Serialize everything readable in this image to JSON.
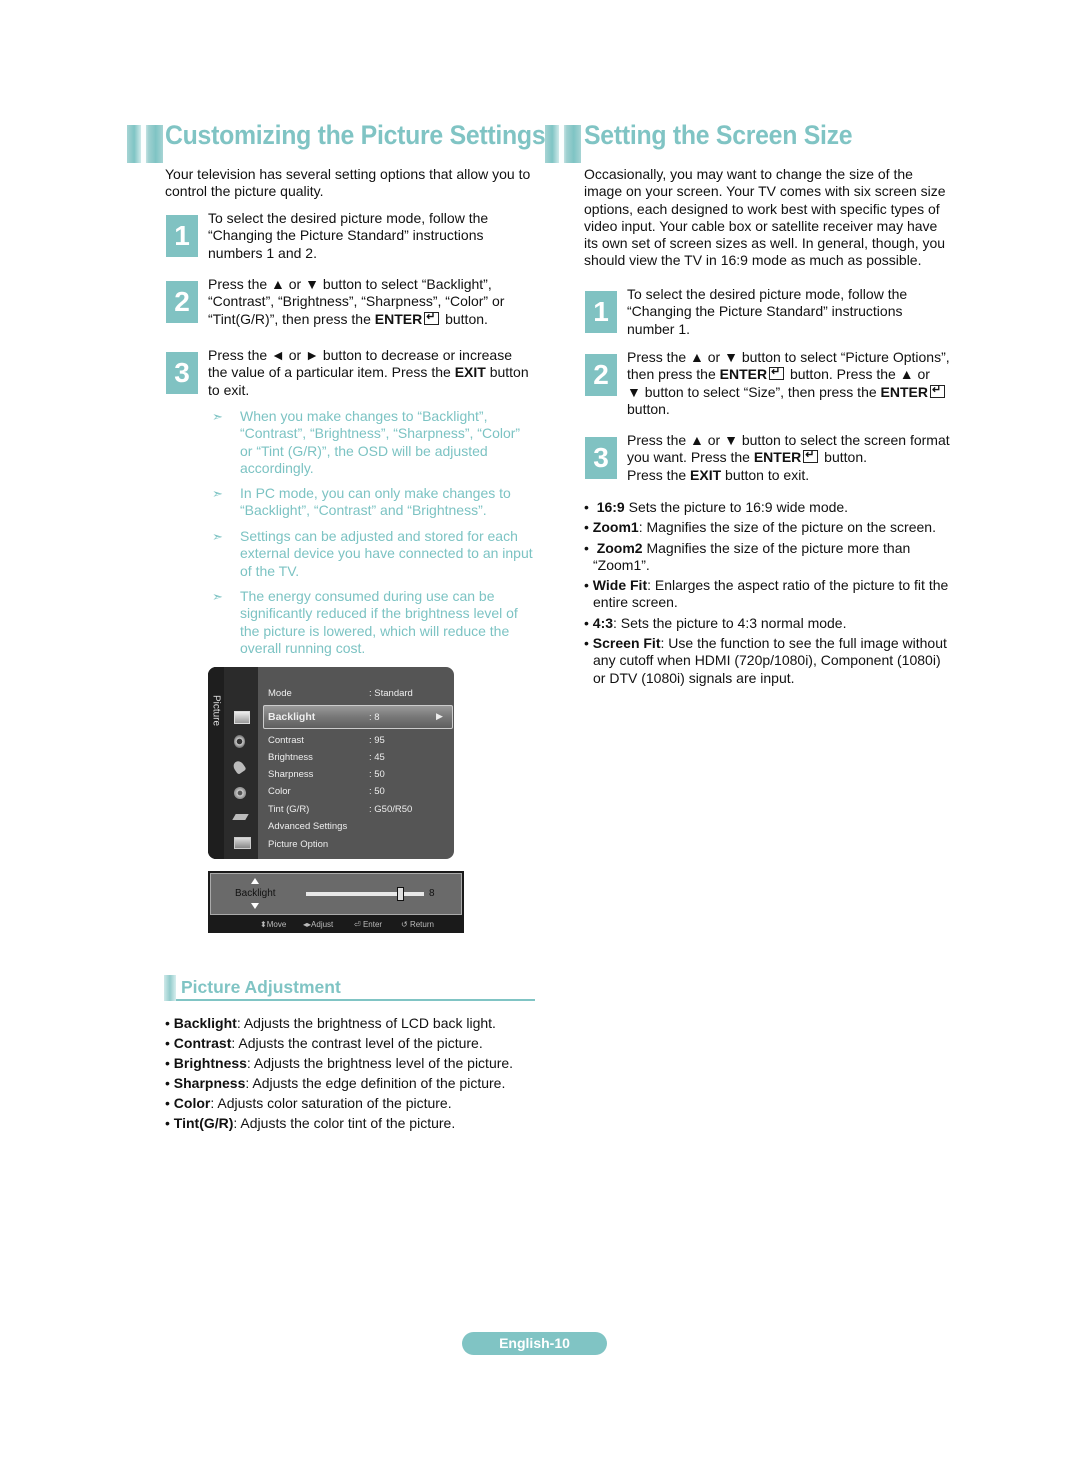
{
  "left": {
    "title": "Customizing the Picture Settings",
    "intro": [
      "Your television has several setting options that allow you to",
      "control the picture quality."
    ],
    "steps": [
      {
        "num": "1",
        "lines": [
          "To select the desired picture mode, follow the",
          "“Changing the Picture Standard” instructions",
          "numbers 1 and 2."
        ]
      },
      {
        "num": "2",
        "lines": [
          "Press the ▲ or ▼ button to select “Backlight”,",
          "“Contrast”, “Brightness”, “Sharpness”, “Color” or"
        ],
        "line3_pre": "“Tint(G/R)”, then press the ",
        "line3_bold": "ENTER",
        "line3_post": " button."
      },
      {
        "num": "3",
        "line1": "Press the ◄ or ► button to decrease or increase",
        "line2_pre": "the value of a particular item. Press the ",
        "line2_bold": "EXIT",
        "line2_post": " button",
        "line3": "to exit."
      }
    ],
    "notes": [
      [
        "When you make changes to “Backlight”,",
        "“Contrast”, “Brightness”, “Sharpness”, “Color”",
        "or “Tint (G/R)”, the OSD will be adjusted",
        "accordingly."
      ],
      [
        "In PC mode, you can only make changes to",
        "“Backlight”, “Contrast” and “Brightness”."
      ],
      [
        "Settings can be adjusted and stored for each",
        "external device you have connected to an input",
        "of the TV."
      ],
      [
        "The energy consumed during use can be",
        "significantly reduced if the brightness level of",
        "the picture is lowered, which will reduce the",
        "overall running cost."
      ]
    ],
    "note_arrow": "➣"
  },
  "osd": {
    "tab_label": "Picture",
    "rows": [
      {
        "label": "Mode",
        "value": ": Standard"
      },
      {
        "label": "Backlight",
        "value": ": 8",
        "selected": true
      },
      {
        "label": "Contrast",
        "value": ": 95"
      },
      {
        "label": "Brightness",
        "value": ": 45"
      },
      {
        "label": "Sharpness",
        "value": ": 50"
      },
      {
        "label": "Color",
        "value": ": 50"
      },
      {
        "label": "Tint (G/R)",
        "value": ": G50/R50"
      },
      {
        "label": "Advanced Settings",
        "value": ""
      },
      {
        "label": "Picture Option",
        "value": ""
      }
    ],
    "selected_arrow": "▶",
    "adjust": {
      "label": "Backlight",
      "value": "8",
      "slider_fraction": 0.8,
      "hints": [
        {
          "icon": "⬍",
          "label": "Move"
        },
        {
          "icon": "◂▸",
          "label": "Adjust"
        },
        {
          "icon": "⏎",
          "label": "Enter"
        },
        {
          "icon": "↺",
          "label": "Return"
        }
      ]
    }
  },
  "adjustment": {
    "title": "Picture Adjustment",
    "items": [
      {
        "term": "Backlight",
        "desc": ": Adjusts the brightness of LCD back light."
      },
      {
        "term": "Contrast",
        "desc": ": Adjusts the contrast level of the picture."
      },
      {
        "term": "Brightness",
        "desc": ": Adjusts the brightness level of the picture."
      },
      {
        "term": "Sharpness",
        "desc": ": Adjusts the edge definition of the picture."
      },
      {
        "term": "Color",
        "desc": ": Adjusts color saturation of the picture."
      },
      {
        "term": "Tint(G/R)",
        "desc": ": Adjusts the color tint of the picture."
      }
    ]
  },
  "right": {
    "title": "Setting the Screen Size",
    "intro": [
      "Occasionally, you may want to change the size of the",
      "image on your screen. Your TV comes with six screen size",
      "options, each designed to work best with specific types of",
      "video input. Your cable box or satellite receiver may have",
      "its own set of screen sizes as well. In general, though, you",
      "should view the TV in 16:9 mode as much as possible."
    ],
    "steps": [
      {
        "num": "1",
        "lines": [
          "To select the desired picture mode, follow the",
          "“Changing the Picture Standard” instructions",
          "number 1."
        ]
      },
      {
        "num": "2",
        "line1": "Press the ▲ or ▼ button to select “Picture Options”,",
        "line2_pre": "then press the ",
        "line2_bold": "ENTER",
        "line2_post": " button. Press the ▲ or",
        "line3_pre": "▼ button to select “Size”, then press the ",
        "line3_bold": "ENTER",
        "line4": "button."
      },
      {
        "num": "3",
        "line1": "Press the ▲ or ▼ button to select the screen format",
        "line2_pre": "you want. Press the ",
        "line2_bold": "ENTER",
        "line2_post": " button.",
        "line3_pre": "Press the ",
        "line3_bold": "EXIT",
        "line3_post": " button to exit."
      }
    ],
    "sizes": [
      {
        "term": "16:9",
        "desc": " Sets the picture to 16:9 wide mode.",
        "lines": []
      },
      {
        "term": "Zoom1",
        "desc": ": Magnifies the size of the picture on the screen.",
        "lines": []
      },
      {
        "term": "Zoom2",
        "desc": " Magnifies the size of the picture more than",
        "lines": [
          "“Zoom1”."
        ]
      },
      {
        "term": "Wide Fit",
        "desc": ": Enlarges the aspect ratio of the picture to fit the",
        "lines": [
          "entire screen."
        ]
      },
      {
        "term": "4:3",
        "desc": ": Sets the picture to 4:3 normal mode.",
        "lines": []
      },
      {
        "term": "Screen Fit",
        "desc": ": Use the function to see the full image without",
        "lines": [
          "any cutoff when HDMI (720p/1080i), Component (1080i)",
          "or DTV (1080i) signals are input."
        ]
      }
    ]
  },
  "footer": {
    "page_label": "English-10"
  },
  "colors": {
    "accent": "#80c4c4",
    "text": "#111111",
    "osd_bg": "#555555"
  }
}
